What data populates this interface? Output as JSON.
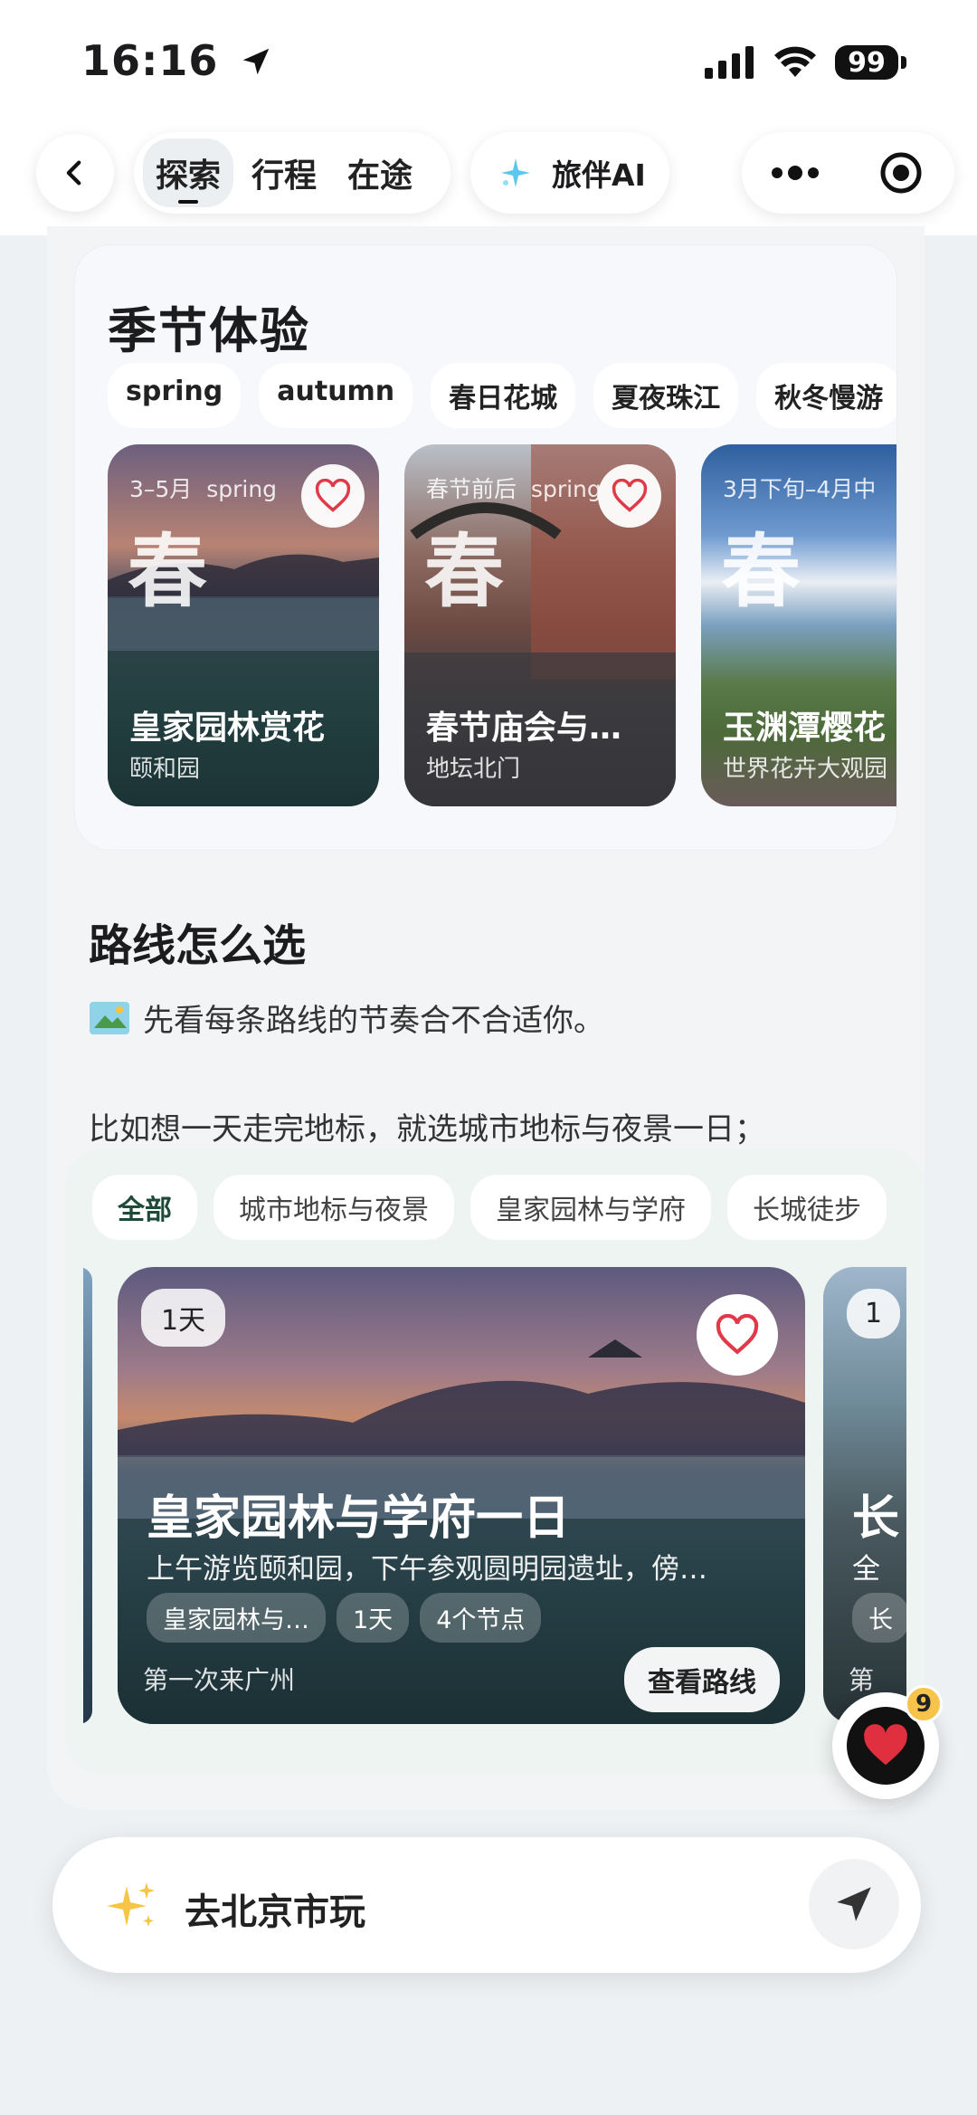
{
  "status": {
    "time": "16:16",
    "battery": "99"
  },
  "nav": {
    "tabs": [
      {
        "label": "探索"
      },
      {
        "label": "行程"
      },
      {
        "label": "在途"
      }
    ],
    "ai_label": "旅伴AI"
  },
  "season": {
    "title": "季节体验",
    "chips": [
      "spring",
      "autumn",
      "春日花城",
      "夏夜珠江",
      "秋冬慢游"
    ],
    "cards": [
      {
        "date": "3–5月",
        "season_tag": "spring",
        "big": "春",
        "name": "皇家园林赏花",
        "place": "颐和园"
      },
      {
        "date": "春节前后",
        "season_tag": "spring",
        "big": "春",
        "name": "春节庙会与…",
        "place": "地坛北门"
      },
      {
        "date": "3月下旬–4月中",
        "season_tag": "",
        "big": "春",
        "name": "玉渊潭樱花",
        "place": "世界花卉大观园"
      }
    ]
  },
  "routes": {
    "title": "路线怎么选",
    "subtitle": "先看每条路线的节奏合不合适你。",
    "desc": "比如想一天走完地标，就选城市地标与夜景一日；",
    "chips": [
      "全部",
      "城市地标与夜景",
      "皇家园林与学府",
      "长城徒步"
    ],
    "card": {
      "days": "1天",
      "title": "皇家园林与学府一日",
      "sub": "上午游览颐和园，下午参观圆明园遗址，傍…",
      "tags": [
        "皇家园林与…",
        "1天",
        "4个节点"
      ],
      "audience": "第一次来广州",
      "view_label": "查看路线"
    },
    "next_card": {
      "days": "1",
      "title": "长",
      "sub": "全",
      "tag": "长",
      "audience": "第"
    }
  },
  "fav_badge": "9",
  "input": {
    "text": "去北京市玩"
  }
}
